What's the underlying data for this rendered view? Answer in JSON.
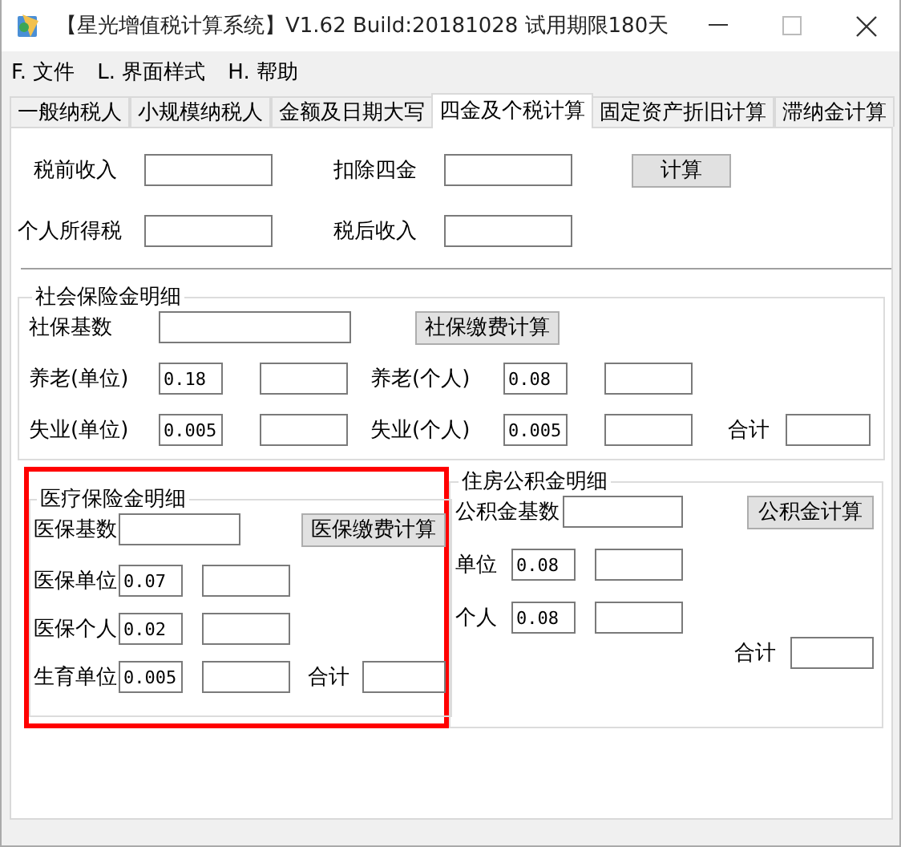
{
  "window": {
    "title": "【星光增值税计算系统】V1.62 Build:20181028 试用期限180天"
  },
  "menu": [
    {
      "label": "F. 文件"
    },
    {
      "label": "L. 界面样式"
    },
    {
      "label": "H. 帮助"
    }
  ],
  "tabs": [
    {
      "label": "一般纳税人",
      "selected": false
    },
    {
      "label": "小规模纳税人",
      "selected": false
    },
    {
      "label": "金额及日期大写",
      "selected": false
    },
    {
      "label": "四金及个税计算",
      "selected": true
    },
    {
      "label": "固定资产折旧计算",
      "selected": false
    },
    {
      "label": "滞纳金计算",
      "selected": false
    }
  ],
  "income": {
    "rows": [
      [
        {
          "kind": "label",
          "text": "税前收入"
        },
        {
          "kind": "amount_field"
        },
        {
          "kind": "label",
          "text": "扣除四金"
        },
        {
          "kind": "amount_field"
        },
        {
          "kind": "button",
          "text": "计算"
        }
      ],
      [
        {
          "kind": "label",
          "text": "个人所得税"
        },
        {
          "kind": "amount_field"
        },
        {
          "kind": "label",
          "text": "税后收入"
        },
        {
          "kind": "amount_field"
        }
      ]
    ]
  },
  "social_insurance": {
    "title": "社会保险金明细",
    "rows": [
      [
        {
          "kind": "label",
          "text": "社保基数"
        },
        {
          "kind": "base_field"
        },
        {
          "kind": "button",
          "text": "社保缴费计算"
        }
      ],
      [
        {
          "kind": "label",
          "text": "养老(单位)"
        },
        {
          "kind": "rate_field",
          "value": "0.18"
        },
        {
          "kind": "amount_field"
        },
        {
          "kind": "label",
          "text": "养老(个人)"
        },
        {
          "kind": "rate_field",
          "value": "0.08"
        },
        {
          "kind": "amount_field"
        }
      ],
      [
        {
          "kind": "label",
          "text": "失业(单位)"
        },
        {
          "kind": "rate_field",
          "value": "0.005"
        },
        {
          "kind": "amount_field"
        },
        {
          "kind": "label",
          "text": "失业(个人)"
        },
        {
          "kind": "rate_field",
          "value": "0.005"
        },
        {
          "kind": "amount_field"
        },
        {
          "kind": "total_label",
          "text": "合计"
        },
        {
          "kind": "total_field"
        }
      ]
    ]
  },
  "medical_insurance": {
    "title": "医疗保险金明细",
    "highlighted": true,
    "rows": [
      [
        {
          "kind": "label",
          "text": "医保基数"
        },
        {
          "kind": "base_field"
        },
        {
          "kind": "button",
          "text": "医保缴费计算"
        }
      ],
      [
        {
          "kind": "label",
          "text": "医保单位"
        },
        {
          "kind": "rate_field",
          "value": "0.07"
        },
        {
          "kind": "amount_field"
        }
      ],
      [
        {
          "kind": "label",
          "text": "医保个人"
        },
        {
          "kind": "rate_field",
          "value": "0.02"
        },
        {
          "kind": "amount_field"
        }
      ],
      [
        {
          "kind": "label",
          "text": "生育单位"
        },
        {
          "kind": "rate_field",
          "value": "0.005"
        },
        {
          "kind": "amount_field"
        },
        {
          "kind": "total_label",
          "text": "合计"
        },
        {
          "kind": "total_field"
        }
      ]
    ]
  },
  "housing_fund": {
    "title": "住房公积金明细",
    "rows": [
      [
        {
          "kind": "label",
          "text": "公积金基数"
        },
        {
          "kind": "base_field"
        },
        {
          "kind": "button",
          "text": "公积金计算"
        }
      ],
      [
        {
          "kind": "label",
          "text": "单位"
        },
        {
          "kind": "rate_field",
          "value": "0.08"
        },
        {
          "kind": "amount_field"
        }
      ],
      [
        {
          "kind": "label",
          "text": "个人"
        },
        {
          "kind": "rate_field",
          "value": "0.08"
        },
        {
          "kind": "amount_field"
        }
      ],
      [
        {
          "kind": "total_label",
          "text": "合计"
        },
        {
          "kind": "total_field"
        }
      ]
    ]
  }
}
